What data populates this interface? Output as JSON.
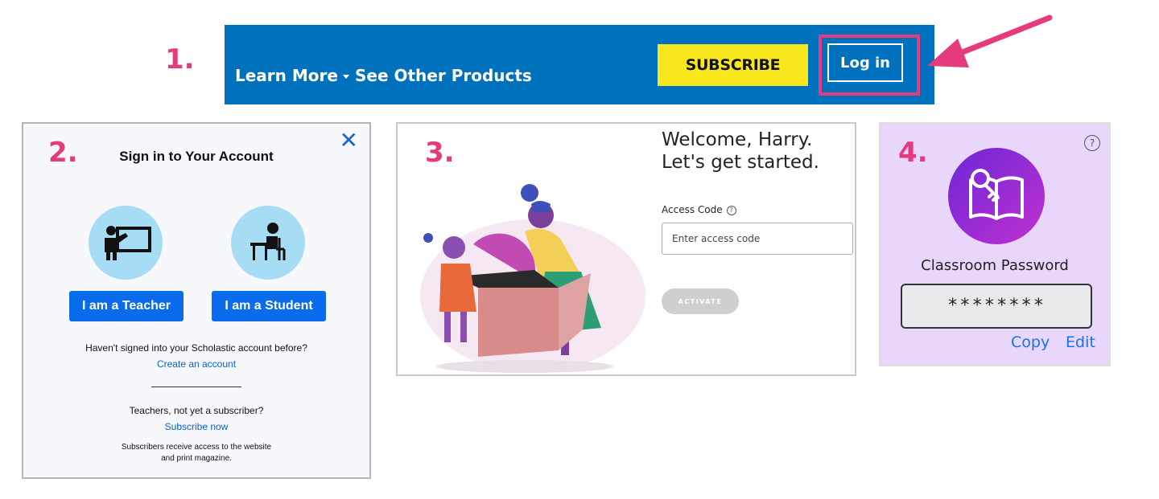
{
  "steps": {
    "one": "1.",
    "two": "2.",
    "three": "3.",
    "four": "4."
  },
  "nav": {
    "learn_more": "Learn More",
    "see_other_products": "See Other Products",
    "subscribe": "SUBSCRIBE",
    "login": "Log in",
    "colors": {
      "bar": "#0071bc",
      "subscribe_bg": "#f8e71c",
      "highlight": "#e53b7c"
    }
  },
  "signin": {
    "title": "Sign in to Your Account",
    "close_icon": "close-icon",
    "teacher_button": "I am a Teacher",
    "student_button": "I am a Student",
    "not_signed_in": "Haven't signed into your Scholastic account before?",
    "create_account": "Create an account",
    "not_subscriber": "Teachers, not yet a subscriber?",
    "subscribe_now": "Subscribe now",
    "subscribers_note_1": "Subscribers receive access to the website",
    "subscribers_note_2": "and print magazine."
  },
  "welcome": {
    "title_line1": "Welcome, Harry.",
    "title_line2": "Let's get started.",
    "access_code_label": "Access Code",
    "access_code_placeholder": "Enter access code",
    "activate": "ACTIVATE"
  },
  "classroom": {
    "label": "Classroom Password",
    "password_masked": "********",
    "copy": "Copy",
    "edit": "Edit",
    "help_icon": "help-icon",
    "icon": "book-key-icon"
  }
}
